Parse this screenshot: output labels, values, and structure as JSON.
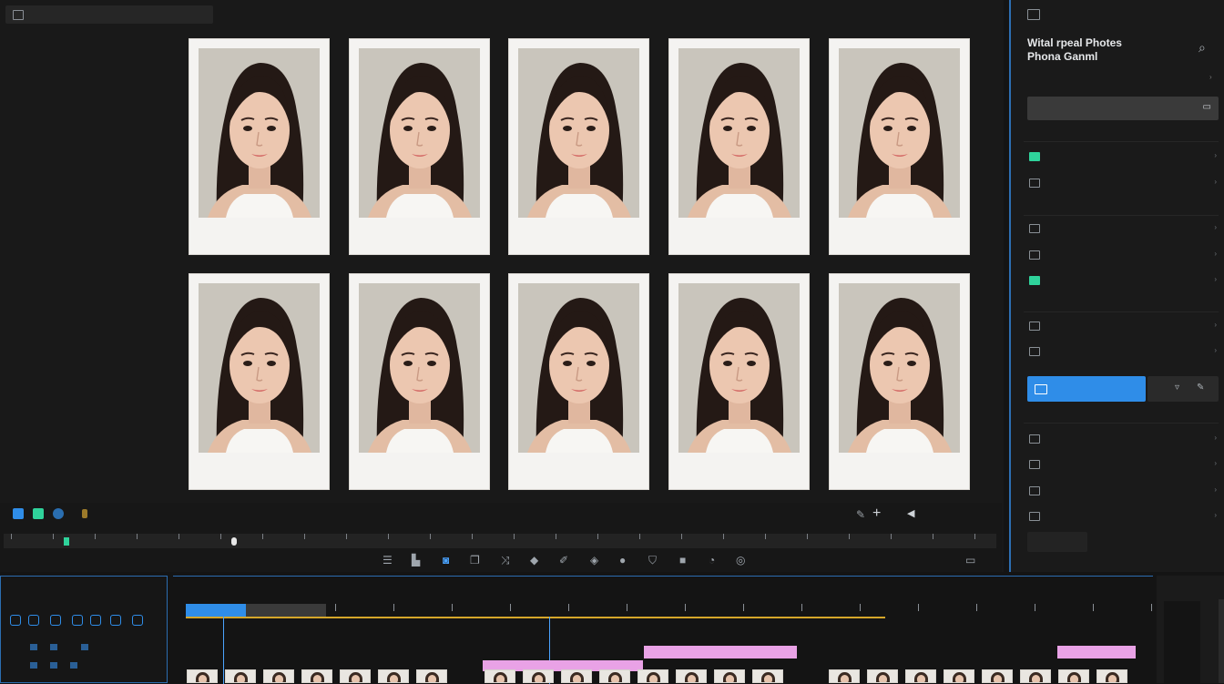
{
  "viewer": {
    "top_label": "",
    "transport_right_label": "",
    "photo_count": 10
  },
  "panel": {
    "title_line1": "Wital rpeal Photes",
    "title_line2": "Phona Ganml",
    "subtitle": "",
    "preset_label": "",
    "items": [
      {
        "label": "",
        "icon": "green-square-icon"
      },
      {
        "label": "",
        "icon": "crop-icon"
      },
      {
        "label": "",
        "icon": "bars-icon"
      },
      {
        "label": "",
        "icon": "flag-icon"
      },
      {
        "label": "",
        "icon": "green-square-icon"
      },
      {
        "label": "",
        "icon": "circle-icon"
      },
      {
        "label": "",
        "icon": "target-icon"
      },
      {
        "label": "",
        "icon": "caret-icon"
      },
      {
        "label": "",
        "icon": "leaf-icon"
      },
      {
        "label": "",
        "icon": "box-icon"
      },
      {
        "label": "",
        "icon": "gear-icon"
      }
    ],
    "active_button": "",
    "bottom_button": ""
  },
  "bottom_left": {
    "line1": "",
    "line2": ""
  },
  "timeline": {
    "label": "",
    "accent_blue": "#2f8de8",
    "accent_pink": "#e9a2e6",
    "accent_yellow": "#d5a62a"
  }
}
